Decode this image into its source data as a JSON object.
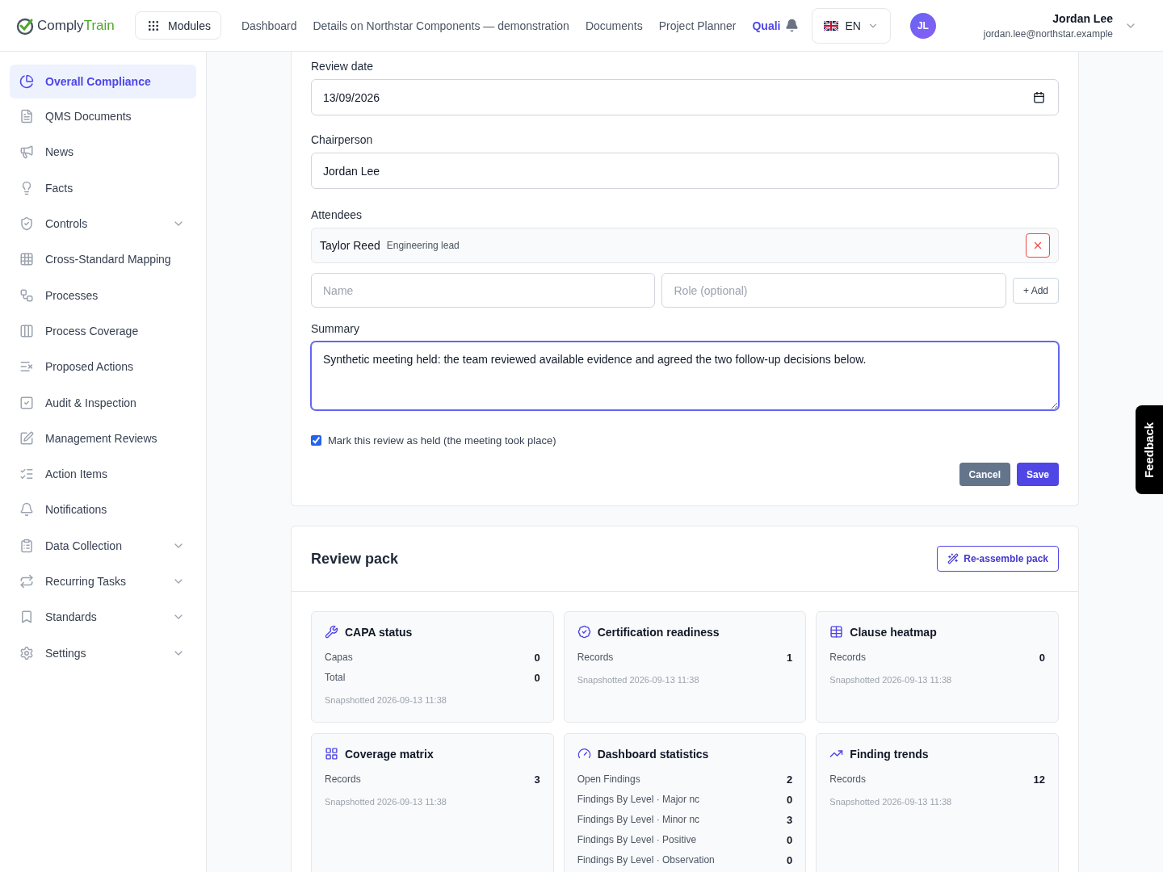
{
  "header": {
    "logo": {
      "part1": "Comply",
      "part2": "Train"
    },
    "modules_button": "Modules",
    "nav": [
      {
        "label": "Dashboard",
        "selected": false
      },
      {
        "label": "Details on Northstar Components — demonstration",
        "selected": false
      },
      {
        "label": "Documents",
        "selected": false
      },
      {
        "label": "Project Planner",
        "selected": false
      },
      {
        "label": "Quali",
        "selected": true
      }
    ],
    "language": "EN",
    "user": {
      "initials": "JL",
      "name": "Jordan Lee",
      "email": "jordan.lee@northstar.example"
    }
  },
  "sidebar": {
    "items": [
      {
        "label": "Overall Compliance",
        "selected": true,
        "expandable": false
      },
      {
        "label": "QMS Documents",
        "selected": false,
        "expandable": false
      },
      {
        "label": "News",
        "selected": false,
        "expandable": false
      },
      {
        "label": "Facts",
        "selected": false,
        "expandable": false
      },
      {
        "label": "Controls",
        "selected": false,
        "expandable": true
      },
      {
        "label": "Cross-Standard Mapping",
        "selected": false,
        "expandable": false
      },
      {
        "label": "Processes",
        "selected": false,
        "expandable": false
      },
      {
        "label": "Process Coverage",
        "selected": false,
        "expandable": false
      },
      {
        "label": "Proposed Actions",
        "selected": false,
        "expandable": false
      },
      {
        "label": "Audit & Inspection",
        "selected": false,
        "expandable": false
      },
      {
        "label": "Management Reviews",
        "selected": false,
        "expandable": false
      },
      {
        "label": "Action Items",
        "selected": false,
        "expandable": false
      },
      {
        "label": "Notifications",
        "selected": false,
        "expandable": false
      },
      {
        "label": "Data Collection",
        "selected": false,
        "expandable": true
      },
      {
        "label": "Recurring Tasks",
        "selected": false,
        "expandable": true
      },
      {
        "label": "Standards",
        "selected": false,
        "expandable": true
      },
      {
        "label": "Settings",
        "selected": false,
        "expandable": true
      }
    ]
  },
  "review_form": {
    "review_date": {
      "label": "Review date",
      "value": "13/09/2026"
    },
    "chairperson": {
      "label": "Chairperson",
      "value": "Jordan Lee"
    },
    "attendees": {
      "label": "Attendees",
      "list": [
        {
          "name": "Taylor Reed",
          "role": "Engineering lead"
        }
      ],
      "name_placeholder": "Name",
      "role_placeholder": "Role (optional)",
      "add_button": "+ Add"
    },
    "summary": {
      "label": "Summary",
      "value": "Synthetic meeting held: the team reviewed available evidence and agreed the two follow-up decisions below."
    },
    "held": {
      "label": "Mark this review as held (the meeting took place)",
      "checked": true
    },
    "cancel_button": "Cancel",
    "save_button": "Save"
  },
  "review_pack": {
    "title": "Review pack",
    "reassemble_button": "Re-assemble pack",
    "cards": [
      {
        "kind": "tools",
        "title": "CAPA status",
        "rows": [
          {
            "label": "Capas",
            "value": "0"
          },
          {
            "label": "Total",
            "value": "0"
          }
        ],
        "snapshot": "Snapshotted 2026-09-13 11:38"
      },
      {
        "kind": "badge",
        "title": "Certification readiness",
        "rows": [
          {
            "label": "Records",
            "value": "1"
          }
        ],
        "snapshot": "Snapshotted 2026-09-13 11:38"
      },
      {
        "kind": "table",
        "title": "Clause heatmap",
        "rows": [
          {
            "label": "Records",
            "value": "0"
          }
        ],
        "snapshot": "Snapshotted 2026-09-13 11:38"
      },
      {
        "kind": "grid",
        "title": "Coverage matrix",
        "rows": [
          {
            "label": "Records",
            "value": "3"
          }
        ],
        "snapshot": "Snapshotted 2026-09-13 11:38"
      },
      {
        "kind": "gauge",
        "title": "Dashboard statistics",
        "rows": [
          {
            "label": "Open Findings",
            "value": "2"
          },
          {
            "label": "Findings By Level · Major nc",
            "value": "0"
          },
          {
            "label": "Findings By Level · Minor nc",
            "value": "3"
          },
          {
            "label": "Findings By Level · Positive",
            "value": "0"
          },
          {
            "label": "Findings By Level · Observation",
            "value": "0"
          }
        ]
      },
      {
        "kind": "trend",
        "title": "Finding trends",
        "rows": [
          {
            "label": "Records",
            "value": "12"
          }
        ],
        "snapshot": "Snapshotted 2026-09-13 11:38"
      }
    ]
  },
  "feedback_tab": "Feedback"
}
